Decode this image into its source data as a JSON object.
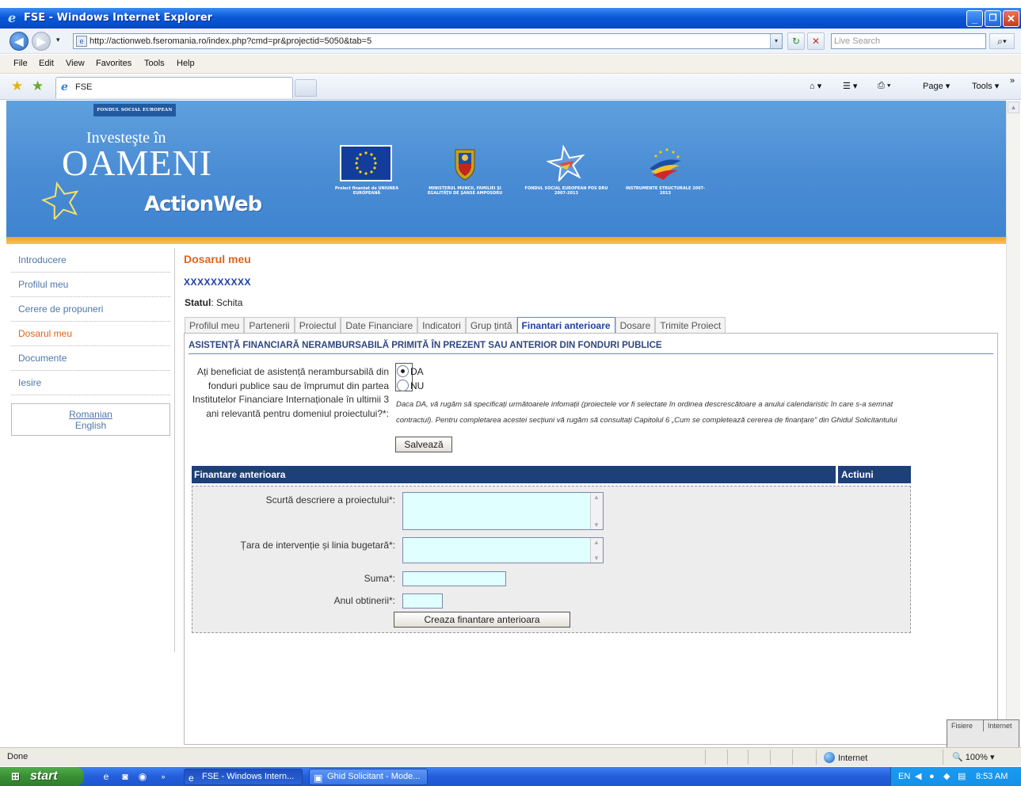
{
  "window": {
    "title": "FSE - Windows Internet Explorer",
    "min": "_",
    "restore": "❐",
    "close": "✕"
  },
  "address": {
    "back": "◀",
    "forward": "▶",
    "drop": "▾",
    "url": "http://actionweb.fseromania.ro/index.php?cmd=pr&projectid=5050&tab=5",
    "refresh": "↻",
    "stop": "✕",
    "search_placeholder": "Live Search",
    "search_go": "⌕▾"
  },
  "menu": [
    "File",
    "Edit",
    "View",
    "Favorites",
    "Tools",
    "Help"
  ],
  "commandbar": {
    "tab_label": "FSE",
    "home": "⌂ ▾",
    "feeds": "☰ ▾",
    "print": "⎙ ▾",
    "page": "Page ▾",
    "tools": "Tools ▾",
    "more": "»"
  },
  "banner": {
    "top_label": "FONDUL SOCIAL EUROPEAN",
    "investeste": "Investeşte în",
    "oameni": "OAMENI",
    "actionweb": "ActionWeb",
    "logos": [
      {
        "caption": "Proiect finanțat de UNIUNEA EUROPEANĂ"
      },
      {
        "caption": "MINISTERUL MUNCII, FAMILIEI ŞI EGALITĂŢII DE ŞANSE AMPOSDRU"
      },
      {
        "caption": "FONDUL SOCIAL EUROPEAN POS DRU 2007-2013"
      },
      {
        "caption": "INSTRUMENTE STRUCTURALE 2007-2013"
      }
    ]
  },
  "sidebar": {
    "items": [
      {
        "label": "Introducere",
        "active": false
      },
      {
        "label": "Profilul meu",
        "active": false
      },
      {
        "label": "Cerere de propuneri",
        "active": false
      },
      {
        "label": "Dosarul meu",
        "active": true
      },
      {
        "label": "Documente",
        "active": false
      },
      {
        "label": "Iesire",
        "active": false
      }
    ],
    "lang_romanian": "Romanian",
    "lang_english": "English"
  },
  "main": {
    "title": "Dosarul meu",
    "project_code": "XXXXXXXXXX",
    "status_label": "Statul",
    "status_value": ": Schita",
    "tabs": [
      {
        "label": "Profilul meu",
        "active": false
      },
      {
        "label": "Partenerii",
        "active": false
      },
      {
        "label": "Proiectul",
        "active": false
      },
      {
        "label": "Date Financiare",
        "active": false
      },
      {
        "label": "Indicatori",
        "active": false
      },
      {
        "label": "Grup țintă",
        "active": false
      },
      {
        "label": "Finantari anterioare",
        "active": true
      },
      {
        "label": "Dosare",
        "active": false
      },
      {
        "label": "Trimite Proiect",
        "active": false
      }
    ],
    "section_heading": "ASISTENȚĂ FINANCIARĂ NERAMBURSABILĂ PRIMITĂ ÎN PREZENT SAU ANTERIOR DIN FONDURI PUBLICE",
    "question": "Ați beneficiat de asistență nerambursabilă din fonduri publice sau de împrumut din partea Institutelor Financiare Internaționale în ultimii 3 ani relevantă pentru domeniul proiectului?*:",
    "radio_da": "DA",
    "radio_nu": "NU",
    "selected": "DA",
    "note_line1": "Daca DA, vă rugăm să specificați următoarele infomații (proiectele vor fi selectate în ordinea descrescătoare a anului calendaristic în care s-a semnat",
    "note_line2": "contractul). Pentru completarea acestei secțiuni vă rugăm să consultați Capitolul 6 „Cum se completează cererea de finanțare” din Ghidul Solicitantului",
    "save_button": "Salvează",
    "table_header_main": "Finantare anterioara",
    "table_header_actions": "Actiuni",
    "form": {
      "desc_label": "Scurtă descriere a proiectului*:",
      "desc_value": "",
      "country_label": "Țara de intervenție și linia bugetară*:",
      "country_value": "",
      "sum_label": "Suma*:",
      "sum_value": "",
      "year_label": "Anul obtinerii*:",
      "year_value": "",
      "create_button": "Creaza finantare anterioara"
    }
  },
  "floating_panel": {
    "left": "Fisiere",
    "right": "Internet"
  },
  "statusbar": {
    "text": "Done",
    "zone": "Internet",
    "zoom": "🔍 100%  ▾"
  },
  "taskbar": {
    "start": "start",
    "tasks": [
      {
        "label": "FSE - Windows Intern...",
        "pressed": true
      },
      {
        "label": "Ghid Solicitant - Mode...",
        "pressed": false
      }
    ],
    "tray_lang": "EN",
    "time": "8:53 AM"
  },
  "colors": {
    "accent_orange": "#e2641b",
    "nav_blue": "#1d3f7a",
    "banner_blue": "#4a8cd4",
    "field_fill": "#e0ffff"
  }
}
